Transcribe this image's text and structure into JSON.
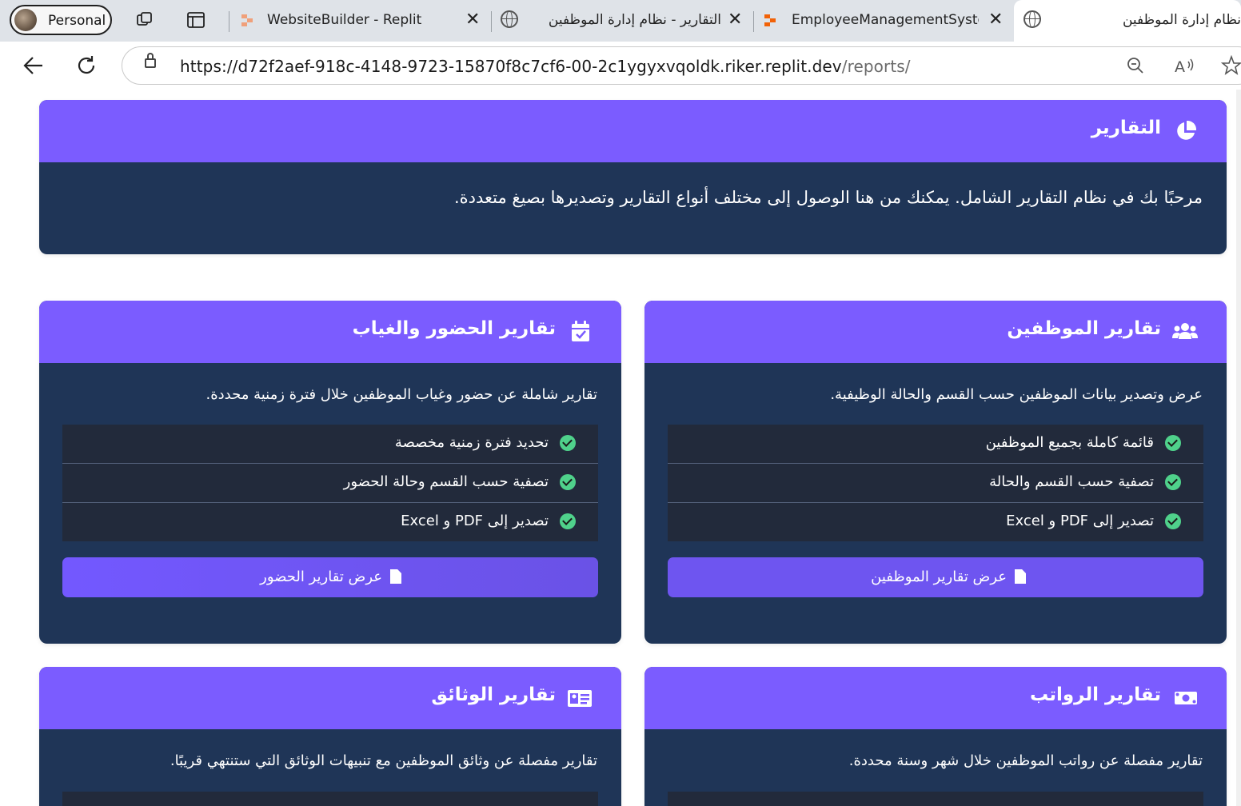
{
  "browser": {
    "profile_label": "Personal",
    "tabs": [
      {
        "title": "WebsiteBuilder - Replit"
      },
      {
        "title": "التقارير - نظام إدارة الموظفين"
      },
      {
        "title": "EmployeeManagementSystem"
      },
      {
        "title": "نظام إدارة الموظفين"
      }
    ],
    "url_main": "https://d72f2aef-918c-4148-9723-15870f8c7cf6-00-2c1ygyxvqoldk.riker.replit.dev",
    "url_path": "/reports/"
  },
  "page": {
    "header": {
      "title": "التقارير",
      "intro": "مرحبًا بك في نظام التقارير الشامل. يمكنك من هنا الوصول إلى مختلف أنواع التقارير وتصديرها بصيغ متعددة."
    },
    "cards": {
      "employees": {
        "title": "تقارير الموظفين",
        "description": "عرض وتصدير بيانات الموظفين حسب القسم والحالة الوظيفية.",
        "features": [
          "قائمة كاملة بجميع الموظفين",
          "تصفية حسب القسم والحالة",
          "تصدير إلى PDF و Excel"
        ],
        "button": "عرض تقارير الموظفين"
      },
      "attendance": {
        "title": "تقارير الحضور والغياب",
        "description": "تقارير شاملة عن حضور وغياب الموظفين خلال فترة زمنية محددة.",
        "features": [
          "تحديد فترة زمنية مخصصة",
          "تصفية حسب القسم وحالة الحضور",
          "تصدير إلى PDF و Excel"
        ],
        "button": "عرض تقارير الحضور"
      },
      "salaries": {
        "title": "تقارير الرواتب",
        "description": "تقارير مفصلة عن رواتب الموظفين خلال شهر وسنة محددة."
      },
      "documents": {
        "title": "تقارير الوثائق",
        "description": "تقارير مفصلة عن وثائق الموظفين مع تنبيهات الوثائق التي ستنتهي قريبًا."
      }
    }
  },
  "colors": {
    "card_header": "#7b5cff",
    "card_body": "#1f3557",
    "feature_row": "#222a3b",
    "button": "#6e55f0",
    "check": "#4fd18b"
  },
  "icons": {
    "reports": "pie-chart-icon",
    "employees": "users-icon",
    "attendance": "calendar-check-icon",
    "salaries": "money-bill-icon",
    "documents": "id-card-icon",
    "button": "file-icon",
    "feature": "check-circle-icon"
  }
}
